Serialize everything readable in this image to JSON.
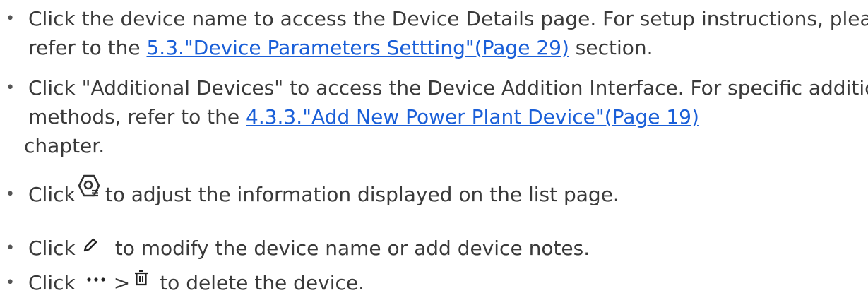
{
  "items": [
    {
      "pre": "Click the device name to access the Device Details page. For setup instructions, please refer to the ",
      "link": "5.3.\"Device Parameters Settting\"(Page 29)",
      "post": " section."
    },
    {
      "pre": "Click \"Additional Devices\" to access the Device Addition Interface. For specific addition methods, refer to the ",
      "link": "4.3.3.\"Add New Power Plant Device\"(Page 19)",
      "post": " chapter."
    },
    {
      "pre": "Click",
      "icon": "list-settings-icon",
      "post": "to adjust the information displayed on the list page."
    },
    {
      "pre": "Click",
      "icon": "pencil-icon",
      "post": "to modify the device name or add device notes."
    },
    {
      "pre": "Click",
      "icon": "more-dots-icon",
      "separator": ">",
      "icon2": "trash-icon",
      "post": "to delete the device."
    }
  ],
  "colors": {
    "text": "#3a3a3a",
    "link": "#1a5fd8"
  }
}
